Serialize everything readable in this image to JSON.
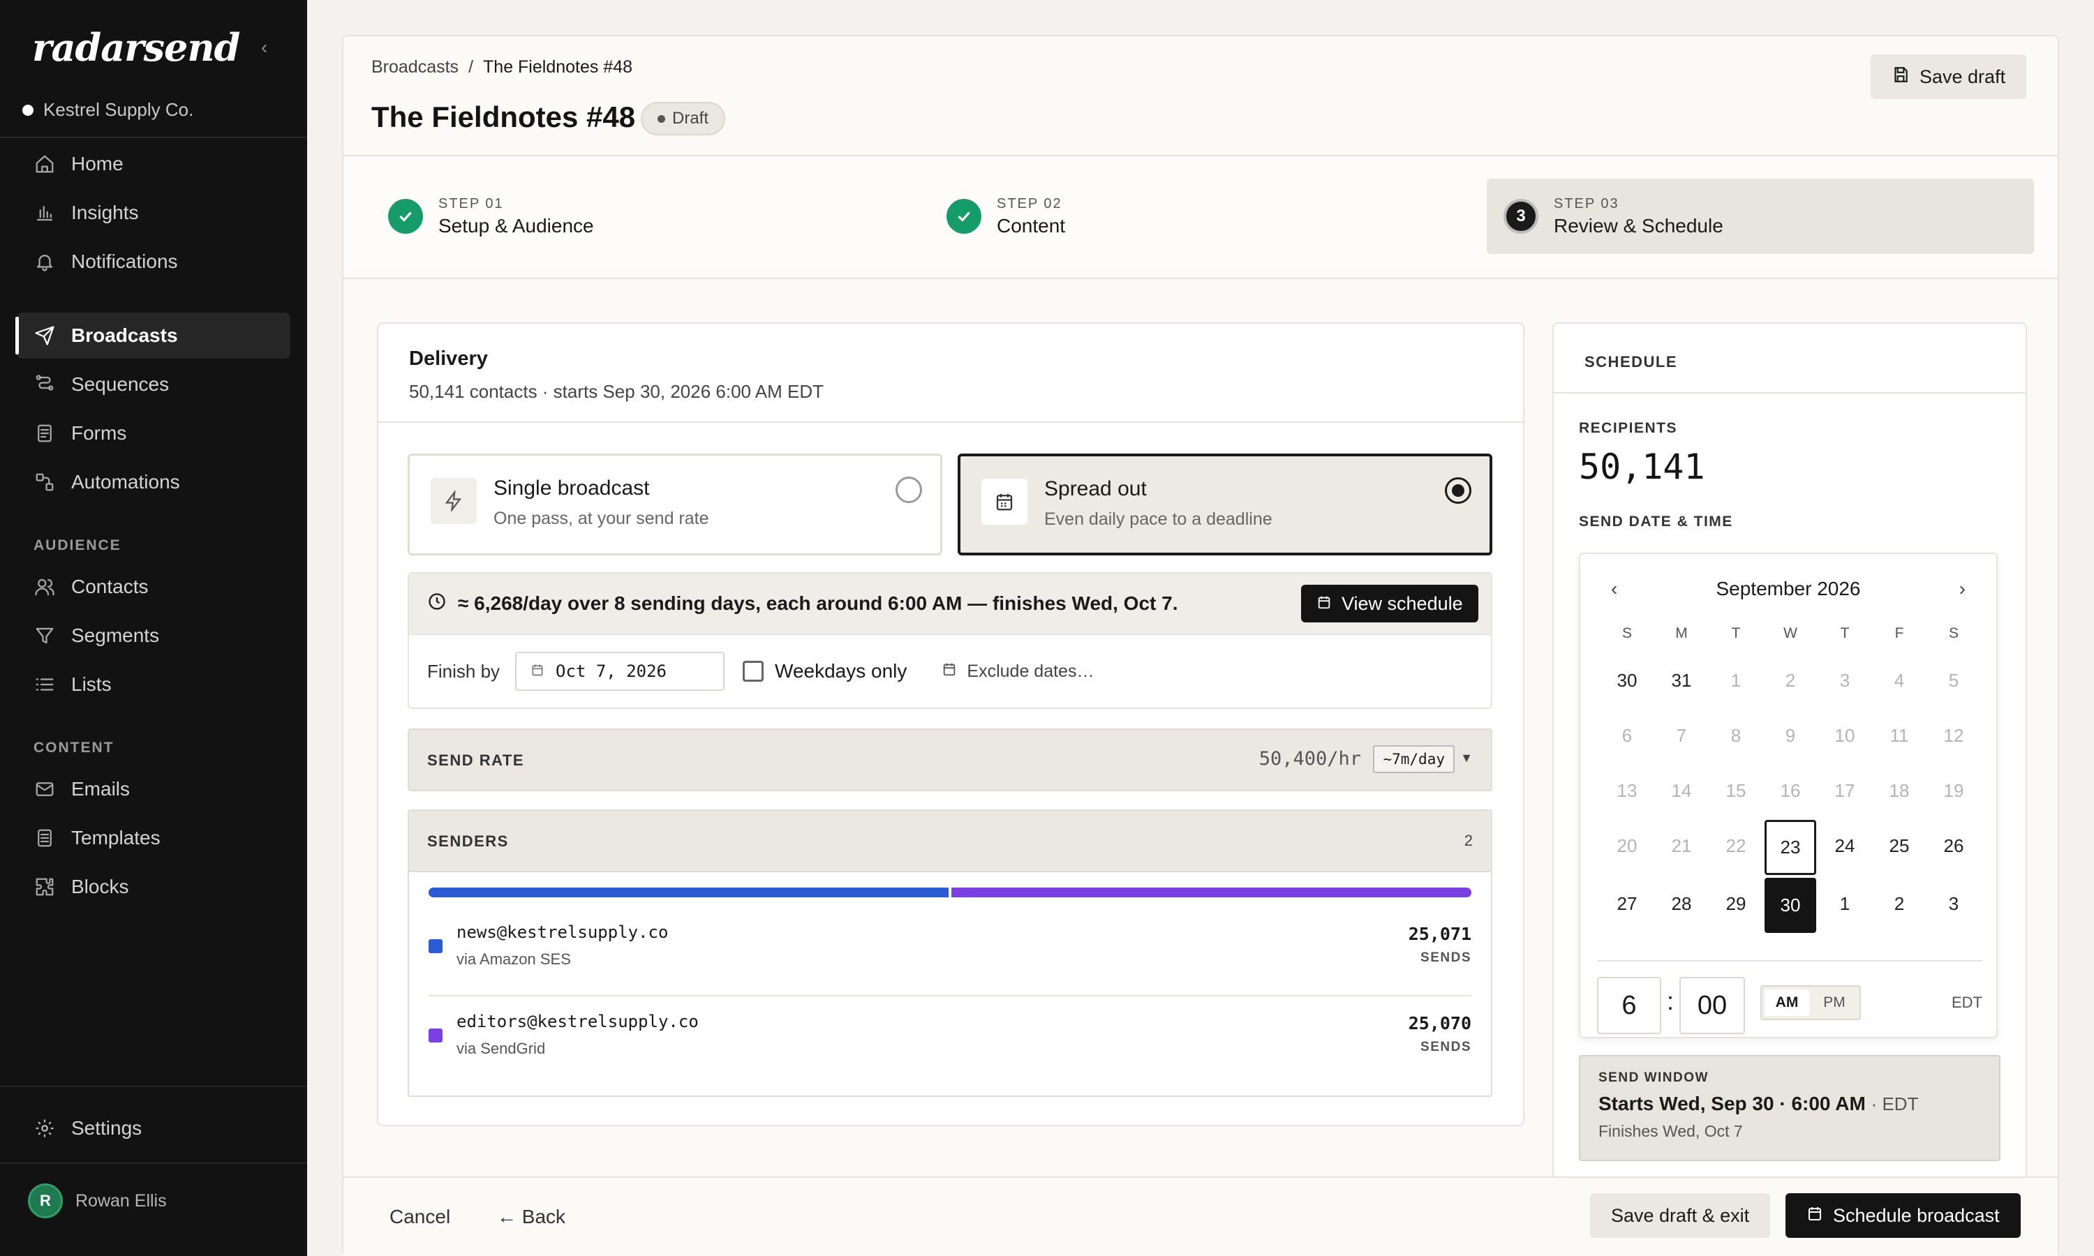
{
  "app": {
    "logo_text": "radarsend",
    "workspace": "Kestrel Supply Co."
  },
  "sidebar": {
    "main_items": [
      {
        "label": "Home",
        "icon": "home-icon"
      },
      {
        "label": "Insights",
        "icon": "bar-chart-icon"
      },
      {
        "label": "Notifications",
        "icon": "bell-icon"
      },
      {
        "label": "Broadcasts",
        "icon": "send-icon",
        "active": true
      },
      {
        "label": "Sequences",
        "icon": "sequence-icon"
      },
      {
        "label": "Forms",
        "icon": "form-icon"
      },
      {
        "label": "Automations",
        "icon": "automation-icon"
      }
    ],
    "audience_label": "AUDIENCE",
    "audience_items": [
      {
        "label": "Contacts",
        "icon": "contacts-icon"
      },
      {
        "label": "Segments",
        "icon": "filter-icon"
      },
      {
        "label": "Lists",
        "icon": "list-icon"
      }
    ],
    "content_label": "CONTENT",
    "content_items": [
      {
        "label": "Emails",
        "icon": "mail-icon"
      },
      {
        "label": "Templates",
        "icon": "template-icon"
      },
      {
        "label": "Blocks",
        "icon": "puzzle-icon"
      }
    ],
    "settings_label": "Settings",
    "user": {
      "initial": "R",
      "name": "Rowan Ellis"
    }
  },
  "header": {
    "breadcrumb_root": "Broadcasts",
    "breadcrumb_sep": "/",
    "breadcrumb_current": "The Fieldnotes #48",
    "title": "The Fieldnotes #48",
    "status_badge": "Draft",
    "save_draft": "Save draft"
  },
  "steps": [
    {
      "num": "STEP 01",
      "label": "Setup & Audience",
      "state": "done"
    },
    {
      "num": "STEP 02",
      "label": "Content",
      "state": "done"
    },
    {
      "num": "STEP 03",
      "label": "Review & Schedule",
      "state": "current",
      "marker": "3"
    }
  ],
  "delivery": {
    "title": "Delivery",
    "subtitle": "50,141 contacts · starts Sep 30, 2026 6:00 AM EDT",
    "single": {
      "title": "Single broadcast",
      "sub": "One pass, at your send rate",
      "selected": false
    },
    "spread": {
      "title": "Spread out",
      "sub": "Even daily pace to a deadline",
      "selected": true
    },
    "summary": "≈ 6,268/day over 8 sending days, each around 6:00 AM — finishes Wed, Oct 7.",
    "view_schedule": "View schedule",
    "finish_by_label": "Finish by",
    "finish_by_value": "Oct 7, 2026",
    "weekdays_only": "Weekdays only",
    "exclude_dates": "Exclude dates…",
    "send_rate_label": "SEND RATE",
    "send_rate_value": "50,400/hr",
    "send_rate_chip": "~7m/day",
    "senders_label": "SENDERS",
    "senders_count": "2",
    "senders": [
      {
        "email": "news@kestrelsupply.co",
        "via": "via Amazon SES",
        "count": "25,071",
        "unit": "SENDS",
        "color": "#2a5bd7"
      },
      {
        "email": "editors@kestrelsupply.co",
        "via": "via SendGrid",
        "count": "25,070",
        "unit": "SENDS",
        "color": "#7b3fe4"
      }
    ],
    "split_fractions": [
      0.5,
      0.5
    ]
  },
  "schedule": {
    "title": "SCHEDULE",
    "recipients_label": "RECIPIENTS",
    "recipients_value": "50,141",
    "send_label": "SEND DATE & TIME",
    "month": "September 2026",
    "weekdays": [
      "S",
      "M",
      "T",
      "W",
      "T",
      "F",
      "S"
    ],
    "days": [
      {
        "d": "30",
        "s": "normal"
      },
      {
        "d": "31",
        "s": "normal"
      },
      {
        "d": "1",
        "s": "muted"
      },
      {
        "d": "2",
        "s": "muted"
      },
      {
        "d": "3",
        "s": "muted"
      },
      {
        "d": "4",
        "s": "muted"
      },
      {
        "d": "5",
        "s": "muted"
      },
      {
        "d": "6",
        "s": "muted"
      },
      {
        "d": "7",
        "s": "muted"
      },
      {
        "d": "8",
        "s": "muted"
      },
      {
        "d": "9",
        "s": "muted"
      },
      {
        "d": "10",
        "s": "muted"
      },
      {
        "d": "11",
        "s": "muted"
      },
      {
        "d": "12",
        "s": "muted"
      },
      {
        "d": "13",
        "s": "muted"
      },
      {
        "d": "14",
        "s": "muted"
      },
      {
        "d": "15",
        "s": "muted"
      },
      {
        "d": "16",
        "s": "muted"
      },
      {
        "d": "17",
        "s": "muted"
      },
      {
        "d": "18",
        "s": "muted"
      },
      {
        "d": "19",
        "s": "muted"
      },
      {
        "d": "20",
        "s": "muted"
      },
      {
        "d": "21",
        "s": "muted"
      },
      {
        "d": "22",
        "s": "muted"
      },
      {
        "d": "23",
        "s": "today"
      },
      {
        "d": "24",
        "s": "normal"
      },
      {
        "d": "25",
        "s": "normal"
      },
      {
        "d": "26",
        "s": "normal"
      },
      {
        "d": "27",
        "s": "normal"
      },
      {
        "d": "28",
        "s": "normal"
      },
      {
        "d": "29",
        "s": "normal"
      },
      {
        "d": "30",
        "s": "sel"
      },
      {
        "d": "1",
        "s": "normal"
      },
      {
        "d": "2",
        "s": "normal"
      },
      {
        "d": "3",
        "s": "normal"
      }
    ],
    "hour": "6",
    "colon": ":",
    "minute": "00",
    "am": "AM",
    "pm": "PM",
    "tz": "EDT",
    "window_label": "SEND WINDOW",
    "window_start": "Starts Wed, Sep 30 · 6:00 AM",
    "window_tz": "· EDT",
    "window_end": "Finishes Wed, Oct 7"
  },
  "footer": {
    "cancel": "Cancel",
    "back": "← Back",
    "save_exit": "Save draft & exit",
    "schedule": "Schedule broadcast"
  }
}
